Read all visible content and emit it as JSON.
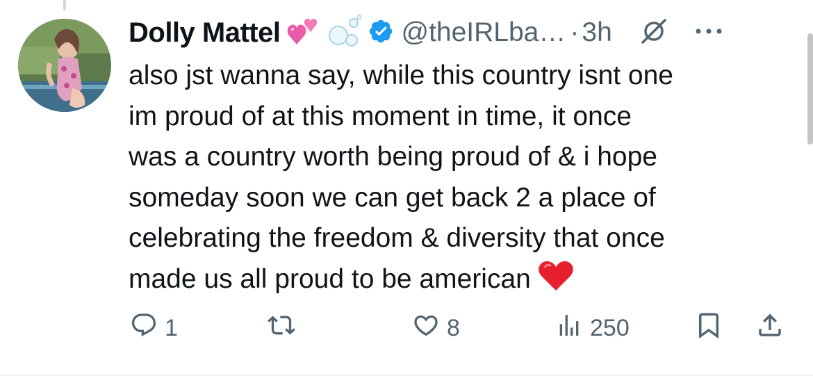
{
  "tweet": {
    "display_name": "Dolly Mattel",
    "name_emojis": [
      "two-hearts-emoji",
      "bubbles-emoji"
    ],
    "verified_icon": "verified-badge-icon",
    "handle": "@theIRLba…",
    "separator": "·",
    "time": "3h",
    "text_lines": [
      "also jst wanna say, while this country isnt one",
      "im proud of at this moment in time, it once",
      "was a country worth being proud of & i hope",
      "someday soon we can get back 2 a place of",
      "celebrating the freedom & diversity that once",
      "made us all proud to be american"
    ],
    "trailing_emoji": "red-heart-emoji"
  },
  "actions": {
    "reply_count": "1",
    "retweet_count": "",
    "like_count": "8",
    "views_count": "250"
  },
  "colors": {
    "text": "#0f1419",
    "secondary": "#536471",
    "verified": "#1d9bf0",
    "heart": "#e0245e"
  }
}
